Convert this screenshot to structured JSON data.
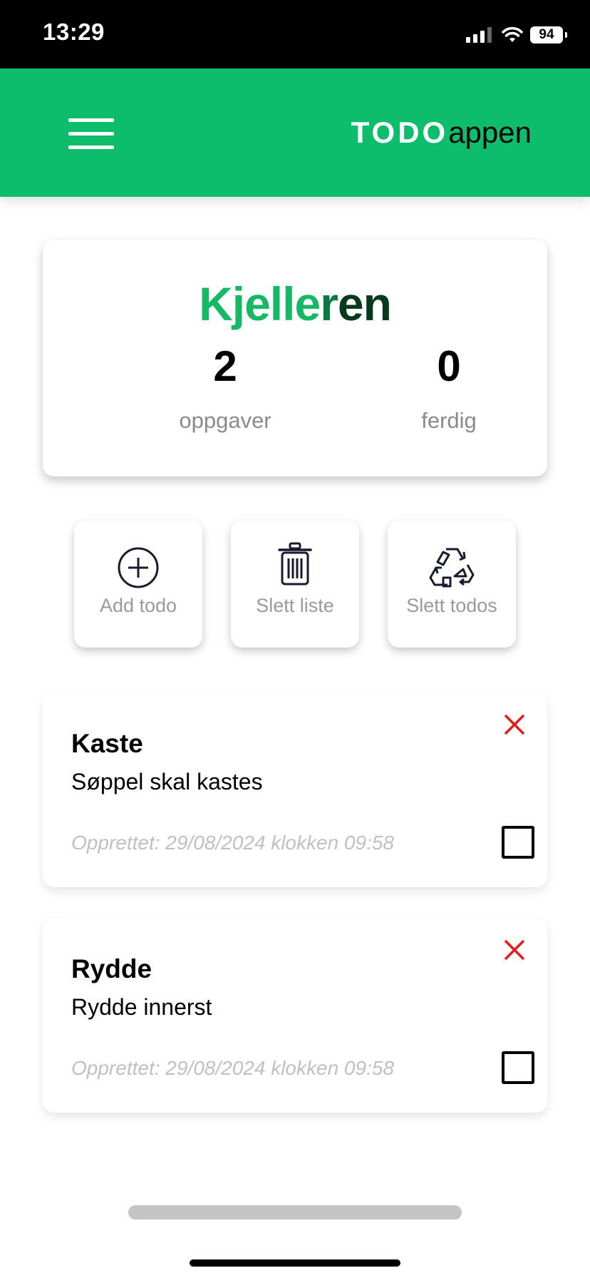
{
  "status_bar": {
    "time": "13:29",
    "battery": "94"
  },
  "header": {
    "brand_bold": "TODO",
    "brand_light": "appen",
    "accent": "#0dbd6b"
  },
  "list": {
    "title_parts": [
      "Kjelle",
      "r",
      "en"
    ],
    "tasks_count": "2",
    "tasks_label": "oppgaver",
    "done_count": "0",
    "done_label": "ferdig"
  },
  "actions": [
    {
      "label": "Add todo",
      "icon": "plus-circle-icon"
    },
    {
      "label": "Slett liste",
      "icon": "trash-icon"
    },
    {
      "label": "Slett todos",
      "icon": "recycle-icon"
    }
  ],
  "todos": [
    {
      "title": "Kaste",
      "description": "Søppel skal kastes",
      "created": "Opprettet: 29/08/2024 klokken 09:58",
      "done": false
    },
    {
      "title": "Rydde",
      "description": "Rydde innerst",
      "created": "Opprettet: 29/08/2024 klokken 09:58",
      "done": false
    }
  ]
}
